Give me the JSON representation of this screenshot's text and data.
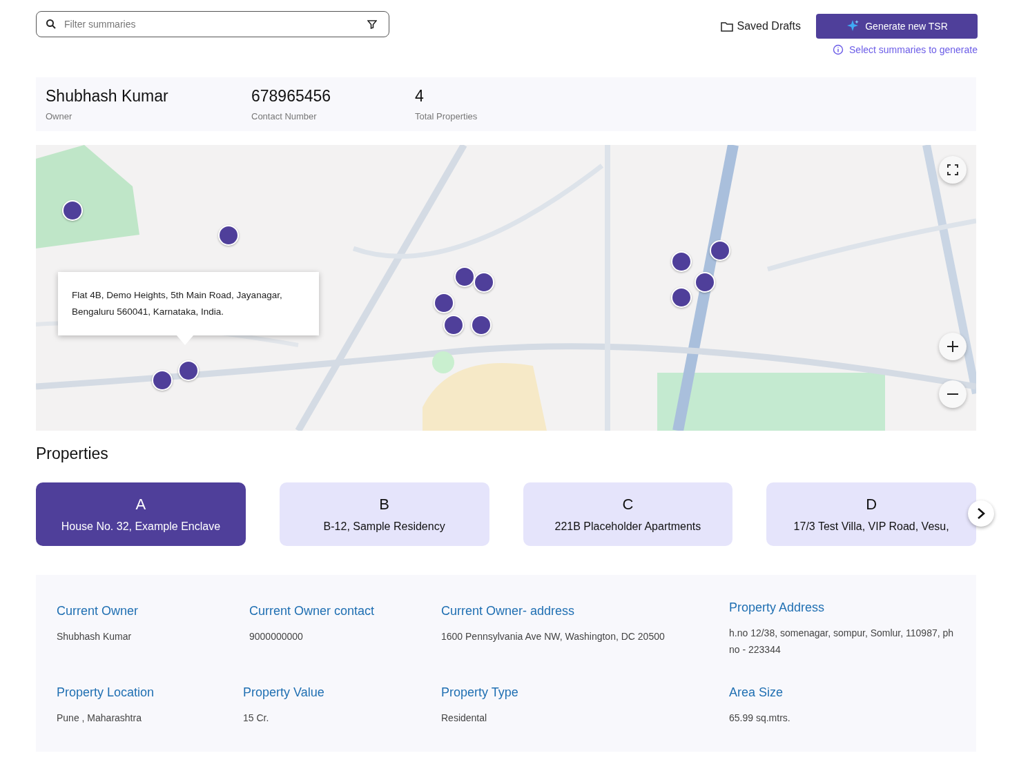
{
  "search": {
    "placeholder": "Filter summaries"
  },
  "actions": {
    "saved_drafts": "Saved Drafts",
    "generate": "Generate new TSR",
    "hint": "Select summaries to generate"
  },
  "summary": [
    {
      "value": "Shubhash Kumar",
      "label": "Owner"
    },
    {
      "value": "678965456",
      "label": "Contact Number"
    },
    {
      "value": "4",
      "label": "Total Properties"
    }
  ],
  "map": {
    "kind": "picture",
    "tooltip": "Flat 4B, Demo Heights, 5th Main Road, Jayanagar, Bengaluru 560041, Karnataka, India."
  },
  "properties_title": "Properties",
  "properties": [
    {
      "letter": "A",
      "address": "House No. 32, Example Enclave",
      "selected": true
    },
    {
      "letter": "B",
      "address": "B-12, Sample Residency",
      "selected": false
    },
    {
      "letter": "C",
      "address": "221B Placeholder Apartments",
      "selected": false
    },
    {
      "letter": "D",
      "address": "17/3 Test Villa, VIP Road, Vesu,",
      "selected": false
    }
  ],
  "details": [
    {
      "label": "Current Owner",
      "value": "Shubhash Kumar"
    },
    {
      "label": "Current Owner contact",
      "value": "9000000000"
    },
    {
      "label": "Current Owner- address",
      "value": "1600 Pennsylvania Ave NW, Washington, DC 20500"
    },
    {
      "label": "Property Address",
      "value": "h.no 12/38, somenagar, sompur, Somlur, 110987, ph no - 223344"
    },
    {
      "label": "Property Location",
      "value": "Pune , Maharashtra"
    },
    {
      "label": "Property Value",
      "value": "15 Cr."
    },
    {
      "label": "Property Type",
      "value": "Residental"
    },
    {
      "label": "Area Size",
      "value": "65.99 sq.mtrs."
    }
  ]
}
